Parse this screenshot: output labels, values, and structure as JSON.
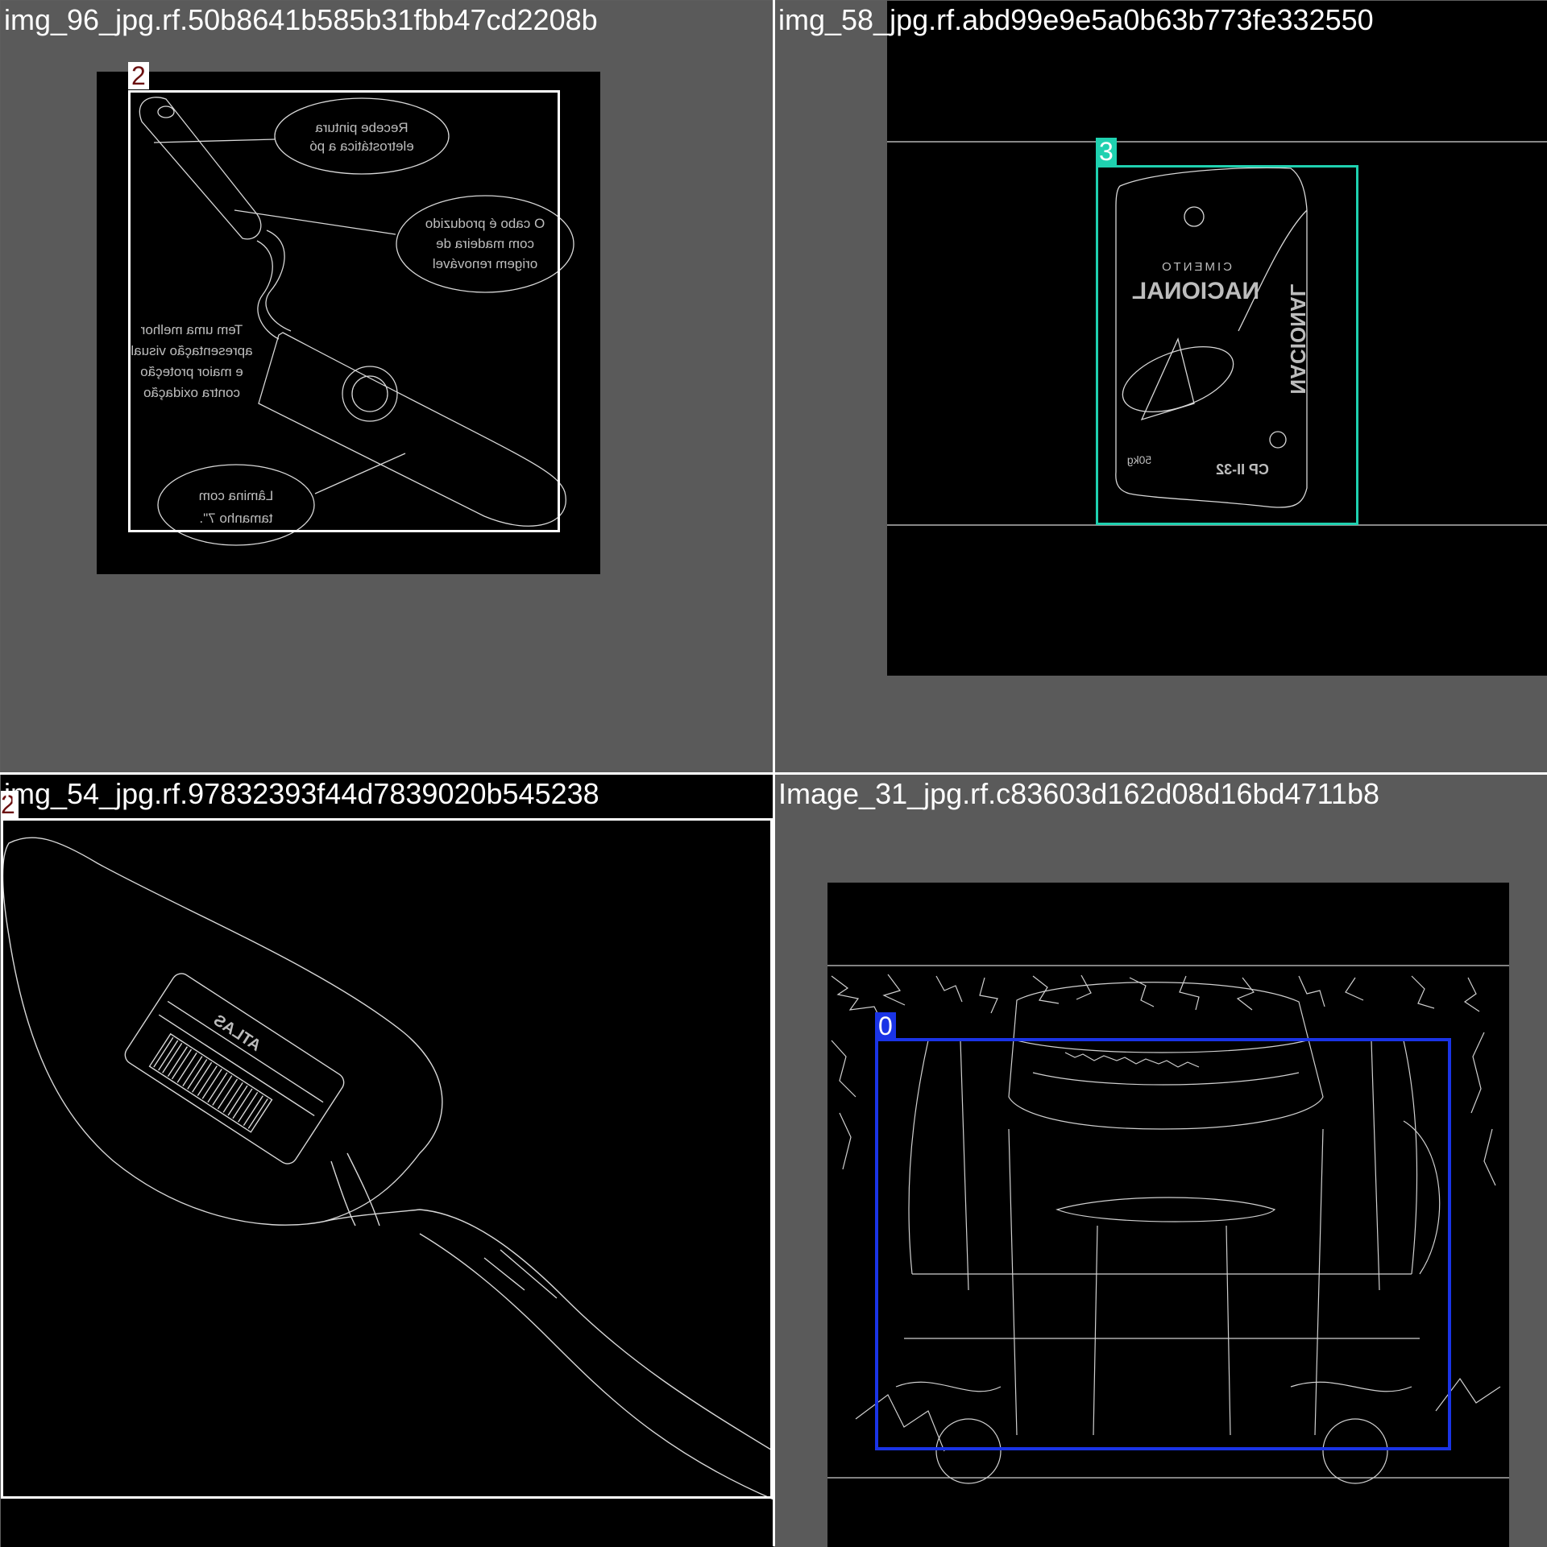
{
  "colors": {
    "background": "#5e5e5e",
    "image": "#000000",
    "edge": "#d8d8d8",
    "box_class_0": "#1a34e6",
    "box_class_2": "#ffffff",
    "box_class_3": "#1fd1b0",
    "label_text_class_2": "#6b1010"
  },
  "tiles": [
    {
      "title": "img_96_jpg.rf.50b8641b585b31fbb47cd2208b",
      "box_label": "2",
      "callouts": [
        "Recebe pintura",
        "eletrostática a pó",
        "O cabo é produzido",
        "com madeira de",
        "origem renovável",
        "Tem uma melhor",
        "apresentação visual",
        "e maior proteção",
        "contra oxidação",
        "Lâmina com",
        "tamanho 7\"."
      ]
    },
    {
      "title": "img_58_jpg.rf.abd99e9e5a0b63b773fe332550",
      "box_label": "3",
      "product_texts": [
        "CIMENTO",
        "NACIONAL",
        "CP II-32",
        "50kg"
      ]
    },
    {
      "title": "img_54_jpg.rf.97832393f44d7839020b545238",
      "box_label": "2",
      "product_texts": [
        "ATLAS"
      ]
    },
    {
      "title": "Image_31_jpg.rf.c83603d162d08d16bd4711b8",
      "box_label": "0"
    }
  ]
}
